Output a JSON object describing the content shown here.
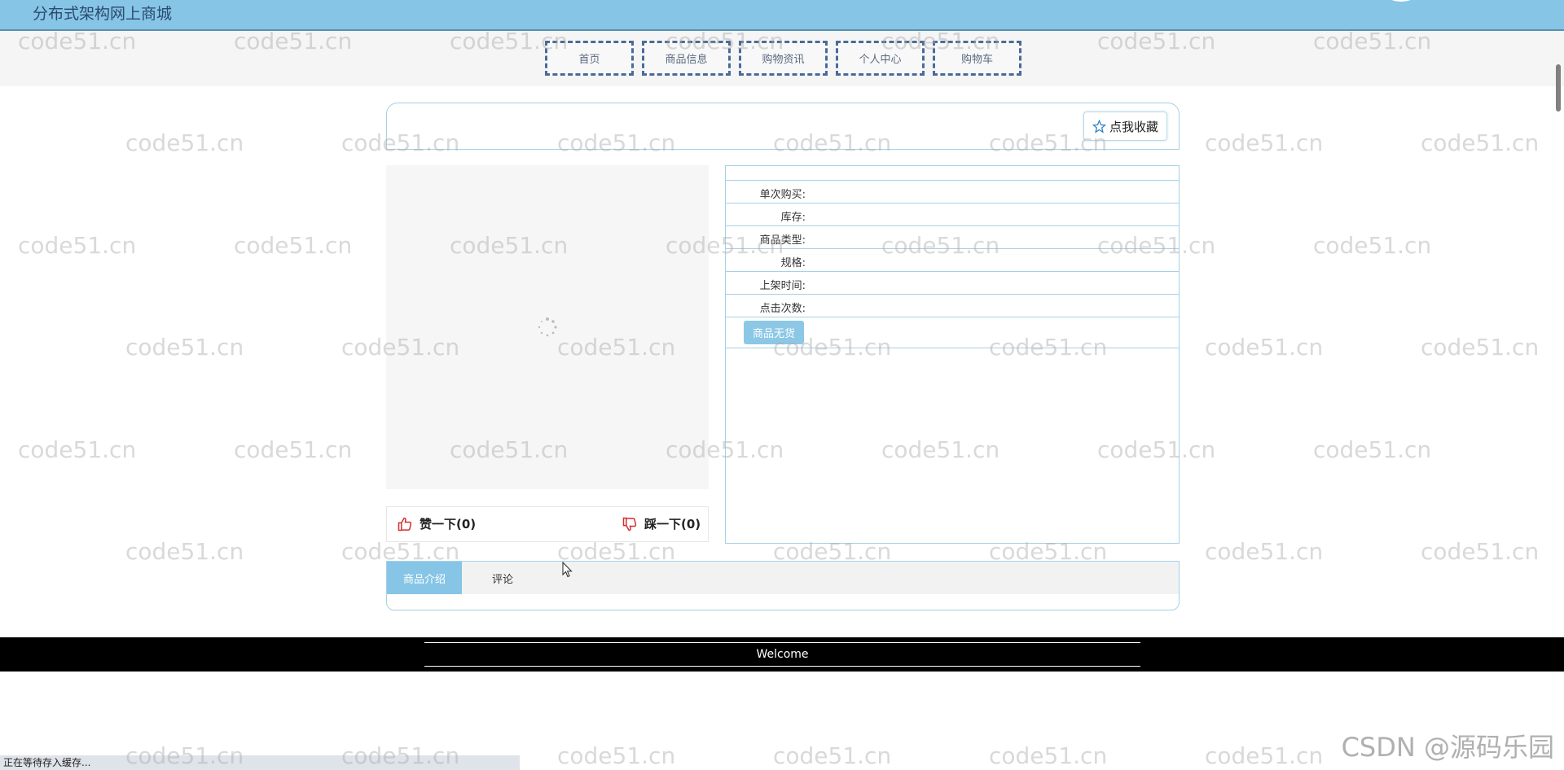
{
  "header": {
    "site_title": "分布式架构网上商城"
  },
  "nav": {
    "items": [
      "首页",
      "商品信息",
      "购物资讯",
      "个人中心",
      "购物车"
    ]
  },
  "favorite": {
    "label": "点我收藏"
  },
  "votes": {
    "up_label": "赞一下(0)",
    "down_label": "踩一下(0)"
  },
  "product_info": {
    "rows": [
      {
        "label": "单次购买:",
        "value": ""
      },
      {
        "label": "库存:",
        "value": ""
      },
      {
        "label": "商品类型:",
        "value": ""
      },
      {
        "label": "规格:",
        "value": ""
      },
      {
        "label": "上架时间:",
        "value": ""
      },
      {
        "label": "点击次数:",
        "value": ""
      }
    ],
    "soldout_label": "商品无货"
  },
  "tabs": {
    "items": [
      "商品介绍",
      "评论"
    ],
    "active": "商品介绍"
  },
  "footer": {
    "text": "Welcome"
  },
  "status_bar": {
    "text": "正在等待存入缓存..."
  },
  "watermark": {
    "text": "code51.cn",
    "corner": "CSDN @源码乐园"
  },
  "colors": {
    "accent": "#86c5e6",
    "border": "#a7d0e6",
    "nav_border": "#4a6b99",
    "footer_bg": "#000000"
  }
}
